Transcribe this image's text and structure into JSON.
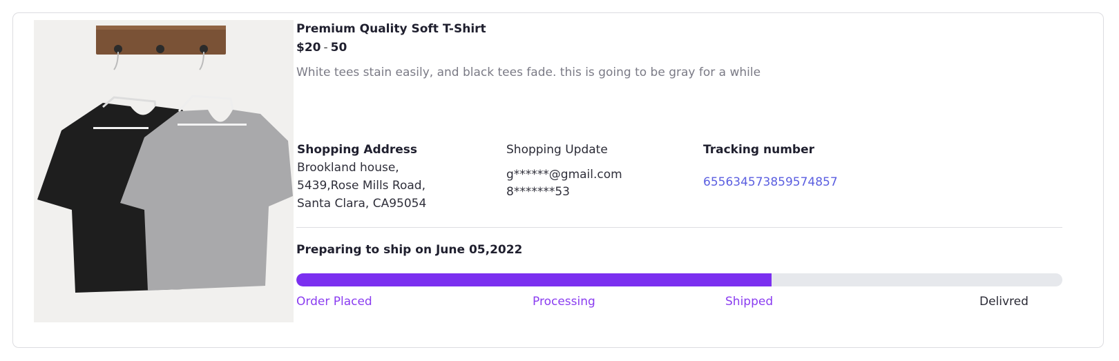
{
  "product": {
    "title": "Premium Quality Soft T-Shirt",
    "price_min": "$20",
    "price_sep": "-",
    "price_max": "50",
    "description": "White tees stain easily, and black tees fade. this is going to be gray for a while",
    "image_alt": "Black and gray t-shirts on hangers"
  },
  "shipping": {
    "address_heading": "Shopping Address",
    "address_lines": [
      "Brookland house,",
      "5439,Rose Mills Road,",
      "Santa Clara, CA95054"
    ],
    "update_heading": "Shopping Update",
    "update_email": "g******@gmail.com",
    "update_phone": "8*******53",
    "tracking_heading": "Tracking number",
    "tracking_number": "655634573859574857"
  },
  "status": {
    "message": "Preparing to ship on June 05,2022",
    "progress_fraction": 0.62,
    "steps": [
      {
        "label": "Order Placed",
        "done": true
      },
      {
        "label": "Processing",
        "done": true
      },
      {
        "label": "Shipped",
        "done": true
      },
      {
        "label": "Delivred",
        "done": false
      }
    ]
  },
  "colors": {
    "accent": "#7b2ff0",
    "link": "#5a5ee0",
    "track": "#e6e8ec"
  }
}
